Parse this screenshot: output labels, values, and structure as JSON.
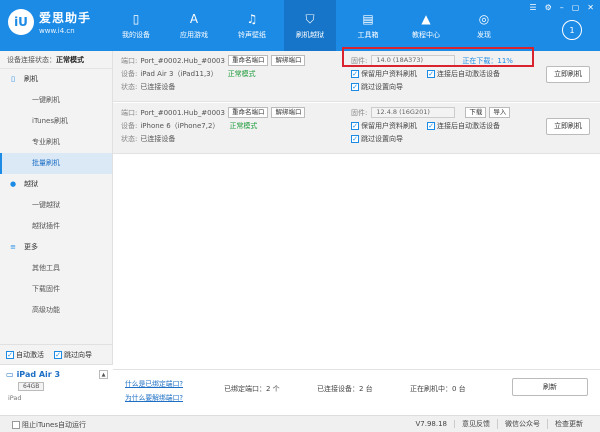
{
  "app": {
    "logo_badge": "iU",
    "name": "爱思助手",
    "url": "www.i4.cn"
  },
  "nav": [
    {
      "label": "我的设备",
      "icon": "phone-icon"
    },
    {
      "label": "应用游戏",
      "icon": "appstore-icon"
    },
    {
      "label": "铃声壁纸",
      "icon": "music-icon"
    },
    {
      "label": "刷机越狱",
      "icon": "shield-icon"
    },
    {
      "label": "工具箱",
      "icon": "toolbox-icon"
    },
    {
      "label": "教程中心",
      "icon": "graduation-icon"
    },
    {
      "label": "发现",
      "icon": "compass-icon"
    }
  ],
  "window": {
    "download_icon": "1"
  },
  "sidebar": {
    "status_label": "设备连接状态：",
    "status_value": "正常模式",
    "flash_section": "刷机",
    "flash_items": [
      "一键刷机",
      "iTunes刷机",
      "专业刷机",
      "批量刷机"
    ],
    "jailbreak_section": "越狱",
    "jailbreak_items": [
      "一键越狱",
      "越狱插件"
    ],
    "more_section": "更多",
    "more_items": [
      "其他工具",
      "下载固件",
      "高级功能"
    ],
    "auto_activate": "自动激活",
    "skip_guide": "跳过向导"
  },
  "device_card": {
    "name": "iPad Air 3",
    "capacity": "64GB",
    "type": "iPad"
  },
  "rows": [
    {
      "port_label": "端口:",
      "port": "Port_#0002.Hub_#0003",
      "rename": "重命名端口",
      "unbind": "解绑端口",
      "device_label": "设备:",
      "device": "iPad Air 3（iPad11,3）",
      "mode": "正常模式",
      "state_label": "状态:",
      "state": "已连接设备",
      "fw_label": "固件:",
      "fw": "14.0 (18A373)",
      "fw_status": "正在下载：11%",
      "opt_keep": "保留用户资料刷机",
      "opt_auto": "连接后自动激活设备",
      "opt_skip": "跳过设置向导",
      "flash_btn": "立即刷机"
    },
    {
      "port_label": "端口:",
      "port": "Port_#0001.Hub_#0003",
      "rename": "重命名端口",
      "unbind": "解绑端口",
      "device_label": "设备:",
      "device": "iPhone 6（iPhone7,2）",
      "mode": "正常模式",
      "state_label": "状态:",
      "state": "已连接设备",
      "fw_label": "固件:",
      "fw": "12.4.8 (16G201)",
      "download_btn": "下载",
      "import_btn": "导入",
      "opt_keep": "保留用户资料刷机",
      "opt_auto": "连接后自动激活设备",
      "opt_skip": "跳过设置向导",
      "flash_btn": "立即刷机"
    }
  ],
  "footer": {
    "link1": "什么是已绑定端口?",
    "link2": "为什么要解绑端口?",
    "bound": "已绑定端口：2 个",
    "connected": "已连接设备：2 台",
    "flashing": "正在刷机中：0 台",
    "refresh": "刷新"
  },
  "statusbar": {
    "block_itunes": "阻止iTunes自动运行",
    "version": "V7.98.18",
    "feedback": "意见反馈",
    "wechat": "微信公众号",
    "update": "检查更新"
  }
}
